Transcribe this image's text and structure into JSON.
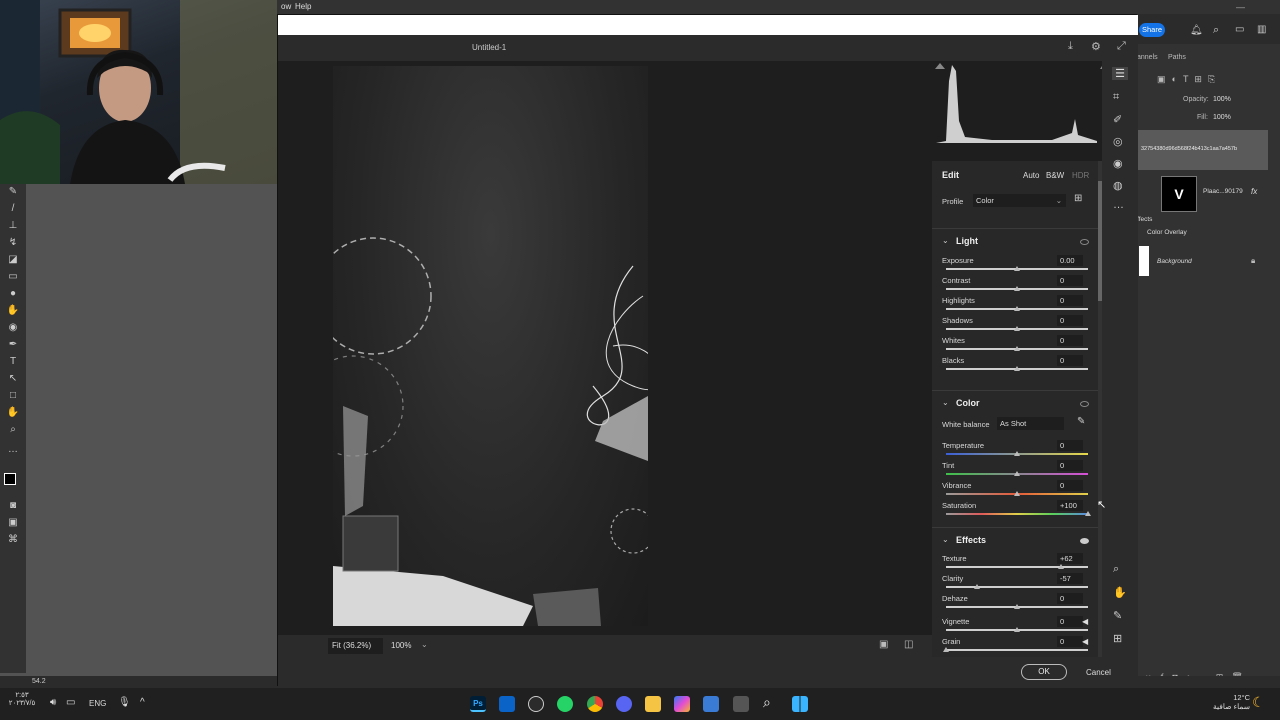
{
  "ps": {
    "menu_window_fragment": "ow",
    "menu_help": "Help",
    "share": "Share",
    "panel_tab_channels": "annels",
    "panel_tab_paths": "Paths",
    "opacity_label": "Opacity:",
    "opacity_value": "100%",
    "fill_label": "Fill:",
    "fill_value": "100%",
    "layer_hash_name": "32754380d96d568f24b413c1aa7a457b",
    "layer_smart_name": "Plaac...90179",
    "fx": "fx",
    "effects_label": "ffects",
    "color_overlay": "Color Overlay",
    "background_layer": "Background",
    "status_zoom_fragment": "54.2"
  },
  "dialog": {
    "title": "Untitled-1",
    "fit_zoom": "Fit (36.2%)",
    "zoom": "100%",
    "ok": "OK",
    "cancel": "Cancel"
  },
  "panel": {
    "edit": "Edit",
    "auto": "Auto",
    "bw": "B&W",
    "hdr": "HDR",
    "profile_label": "Profile",
    "profile_value": "Color",
    "light": {
      "title": "Light",
      "sliders": [
        {
          "label": "Exposure",
          "value": "0.00",
          "level": 0.5
        },
        {
          "label": "Contrast",
          "value": "0",
          "level": 0.5
        },
        {
          "label": "Highlights",
          "value": "0",
          "level": 0.5
        },
        {
          "label": "Shadows",
          "value": "0",
          "level": 0.5
        },
        {
          "label": "Whites",
          "value": "0",
          "level": 0.5
        },
        {
          "label": "Blacks",
          "value": "0",
          "level": 0.5
        }
      ]
    },
    "color": {
      "title": "Color",
      "wb_label": "White balance",
      "wb_value": "As Shot",
      "sliders": [
        {
          "label": "Temperature",
          "value": "0",
          "level": 0.5,
          "gradient": "linear-gradient(90deg,#3a5fd6,#e6d84a)"
        },
        {
          "label": "Tint",
          "value": "0",
          "level": 0.5,
          "gradient": "linear-gradient(90deg,#3fc04a,#d54fd6)"
        },
        {
          "label": "Vibrance",
          "value": "0",
          "level": 0.5,
          "gradient": "linear-gradient(90deg,#9a9a9a,#e55b3a,#e0d04a)"
        },
        {
          "label": "Saturation",
          "value": "+100",
          "level": 1.0,
          "gradient": "linear-gradient(90deg,#9a9a9a,#e05a5a,#e0d04a,#5ad05a,#5a8ae0)"
        }
      ]
    },
    "effects": {
      "title": "Effects",
      "sliders": [
        {
          "label": "Texture",
          "value": "+62",
          "level": 0.81
        },
        {
          "label": "Clarity",
          "value": "-57",
          "level": 0.215
        },
        {
          "label": "Dehaze",
          "value": "0",
          "level": 0.5
        },
        {
          "label": "Vignette",
          "value": "0",
          "level": 0.5
        },
        {
          "label": "Grain",
          "value": "0",
          "level": 0.0
        }
      ]
    }
  },
  "taskbar": {
    "time": "٢:٥٣",
    "date": "٢٠٢٣/٧/٥",
    "lang": "ENG",
    "weather_temp": "12°C",
    "weather_desc": "سماء صافية"
  }
}
